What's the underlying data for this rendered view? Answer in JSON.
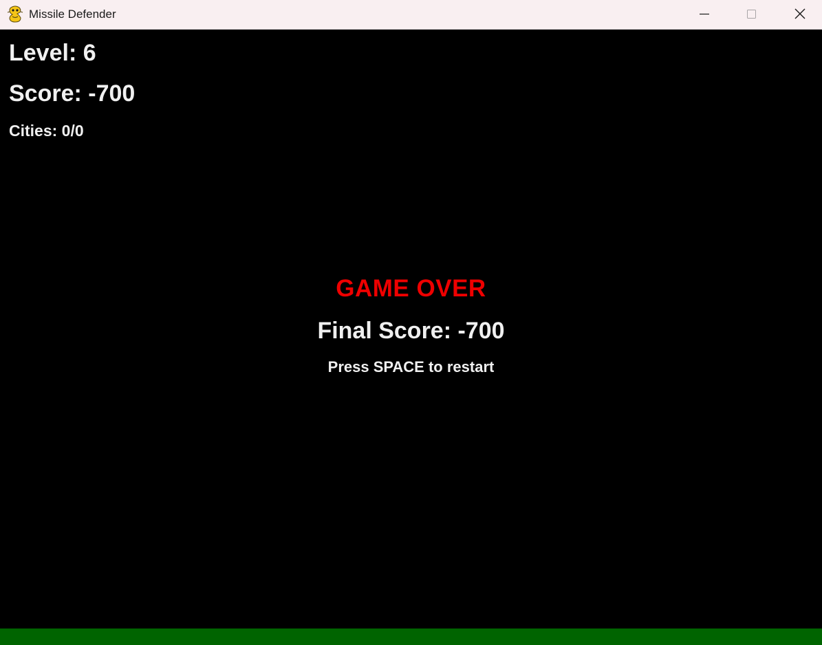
{
  "window": {
    "title": "Missile Defender",
    "app_icon": "python-snake-icon"
  },
  "hud": {
    "level": "Level: 6",
    "score": "Score: -700",
    "cities": "Cities: 0/0"
  },
  "game_over": {
    "heading": "GAME OVER",
    "final_score": "Final Score: -700",
    "prompt": "Press SPACE to restart"
  },
  "colors": {
    "titlebar": "#f9eff1",
    "background": "#000000",
    "text": "#f0f0f0",
    "game_over": "#ee0000",
    "ground": "#006400"
  }
}
